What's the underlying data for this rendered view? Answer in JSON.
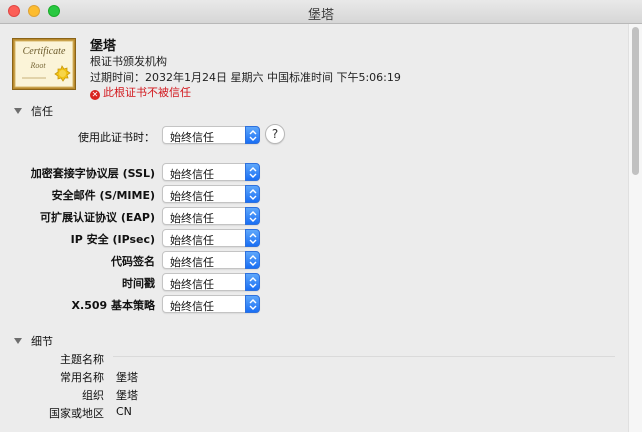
{
  "window": {
    "title": "堡塔"
  },
  "certificate": {
    "image_text": "Certificate",
    "image_subtext": "Root",
    "name": "堡塔",
    "type": "根证书颁发机构",
    "expiry": "过期时间：2032年1月24日 星期六 中国标准时间 下午5:06:19",
    "warning": "此根证书不被信任"
  },
  "trust": {
    "section_title": "信任",
    "use_label": "使用此证书时：",
    "use_value": "始终信任",
    "help_label": "?",
    "policies": [
      {
        "label": "加密套接字协议层 (SSL)",
        "value": "始终信任"
      },
      {
        "label": "安全邮件 (S/MIME)",
        "value": "始终信任"
      },
      {
        "label": "可扩展认证协议 (EAP)",
        "value": "始终信任"
      },
      {
        "label": "IP 安全 (IPsec)",
        "value": "始终信任"
      },
      {
        "label": "代码签名",
        "value": "始终信任"
      },
      {
        "label": "时间戳",
        "value": "始终信任"
      },
      {
        "label": "X.509 基本策略",
        "value": "始终信任"
      }
    ]
  },
  "details": {
    "section_title": "细节",
    "subject_header": "主题名称",
    "rows": [
      {
        "label": "常用名称",
        "value": "堡塔"
      },
      {
        "label": "组织",
        "value": "堡塔"
      },
      {
        "label": "国家或地区",
        "value": "CN"
      }
    ]
  },
  "colors": {
    "accent": "#1a6ff4",
    "warning": "#d2171d"
  },
  "icons": {
    "warning": "x-circle-icon",
    "disclosure": "disclosure-triangle-icon",
    "popup": "updown-chevron-icon"
  }
}
